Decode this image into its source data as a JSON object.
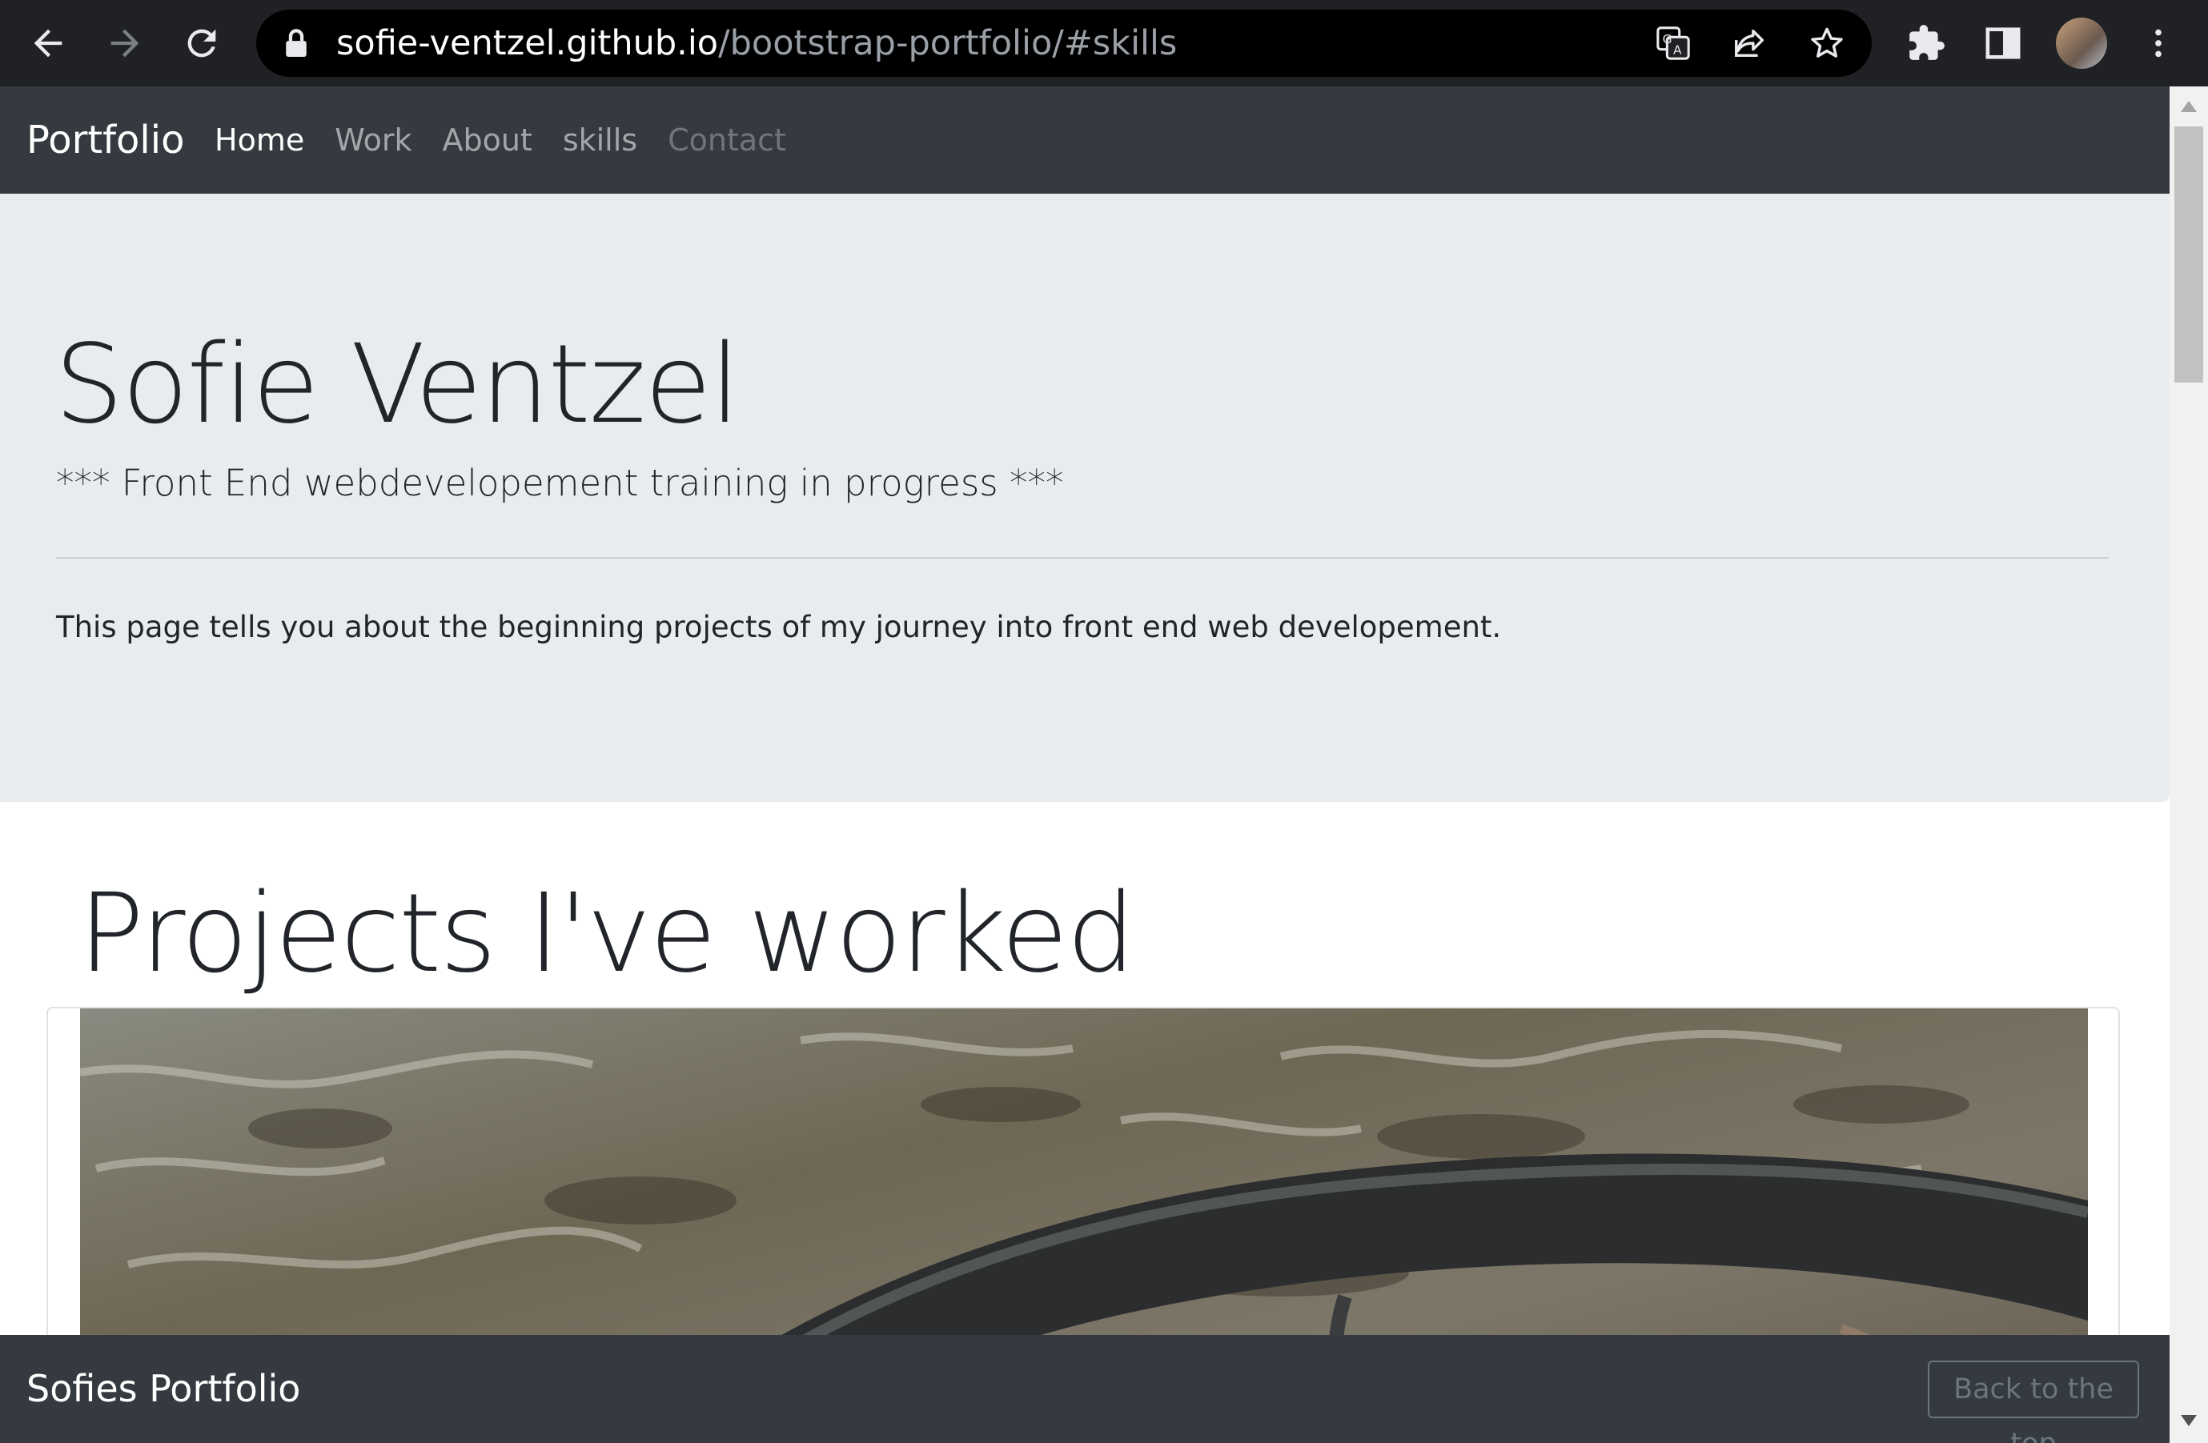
{
  "browser": {
    "url_host": "sofie-ventzel.github.io",
    "url_path": "/bootstrap-portfolio/#skills",
    "icons": [
      "back-icon",
      "forward-icon",
      "reload-icon",
      "lock-icon",
      "translate-icon",
      "share-icon",
      "star-icon",
      "extensions-icon",
      "side-panel-icon",
      "avatar",
      "menu-icon"
    ]
  },
  "navbar": {
    "brand": "Portfolio",
    "links": [
      {
        "label": "Home",
        "state": "active"
      },
      {
        "label": "Work",
        "state": "normal"
      },
      {
        "label": "About",
        "state": "normal"
      },
      {
        "label": "skills",
        "state": "normal"
      },
      {
        "label": "Contact",
        "state": "disabled"
      }
    ]
  },
  "jumbotron": {
    "title": "Sofie Ventzel",
    "lead": "*** Front End webdevelopement training in progress ***",
    "text": "This page tells you about the beginning projects of my journey into front end web developement."
  },
  "projects": {
    "title": "Projects I've worked"
  },
  "footer": {
    "brand": "Sofies Portfolio",
    "back_to_top": "Back to the top"
  },
  "colors": {
    "chrome_bg": "#202124",
    "navbar_bg": "#343a40",
    "jumbotron_bg": "#e9ecef",
    "text": "#212529"
  }
}
